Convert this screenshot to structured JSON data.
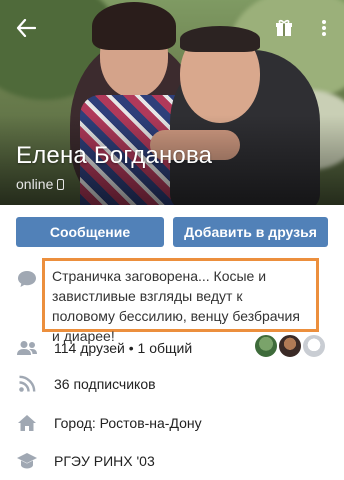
{
  "profile": {
    "name": "Елена Богданова",
    "online": "online"
  },
  "actions": {
    "message": "Сообщение",
    "add_friend": "Добавить в друзья"
  },
  "status": {
    "text": "Страничка заговорена... Косые и завистливые взгляды ведут к половому бессилию, венцу безбрачия и диарее!"
  },
  "info": {
    "friends": "114 друзей • 1 общий",
    "followers": "36 подписчиков",
    "city": "Город: Ростов-на-Дону",
    "education": "РГЭУ РИНХ '03"
  },
  "colors": {
    "accent": "#5181b8",
    "highlight_border": "#ec8f3d",
    "icon_gray": "#a0a8b3"
  },
  "icons": {
    "back": "arrow-left-icon",
    "gift": "gift-icon",
    "menu": "more-vertical-icon",
    "status": "speech-bubble-icon",
    "friends": "people-icon",
    "followers": "rss-icon",
    "city": "home-icon",
    "education": "graduation-cap-icon"
  }
}
